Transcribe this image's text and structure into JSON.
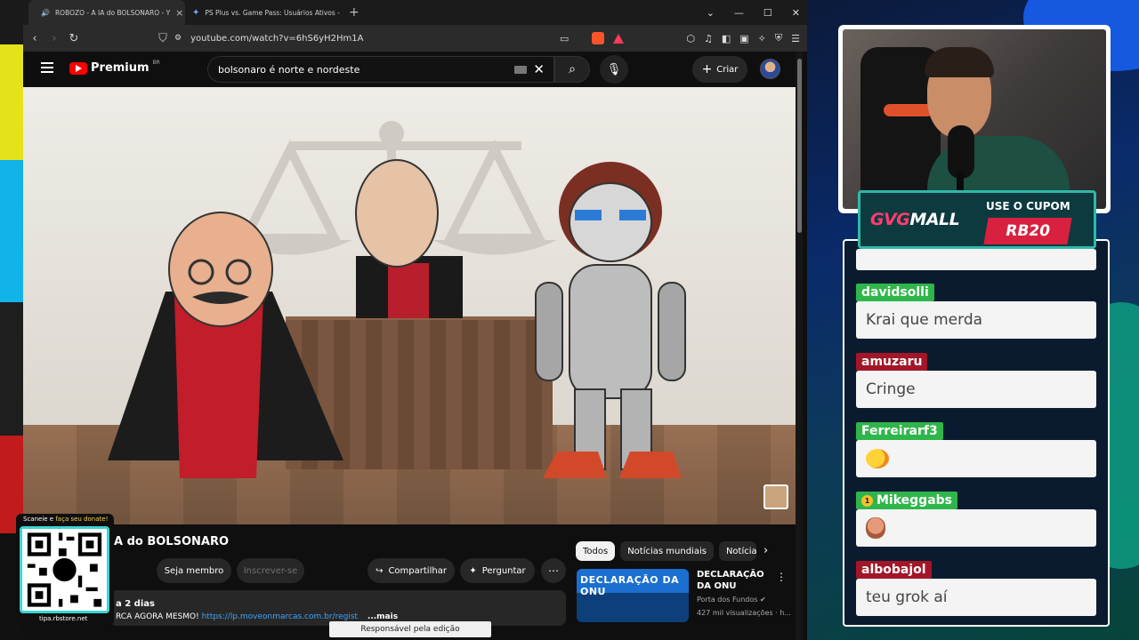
{
  "browser": {
    "tabs": [
      {
        "title": "ROBOZO - A IA do BOLSONARO - Y",
        "active": true
      },
      {
        "title": "PS Plus vs. Game Pass: Usuários Ativos - Goo",
        "active": false
      }
    ],
    "url": "youtube.com/watch?v=6hS6yH2Hm1A"
  },
  "youtube": {
    "brand": "Premium",
    "region": "BR",
    "search_query": "bolsonaro é norte e nordeste",
    "create_label": "Criar",
    "video_title_visible": "A do BOLSONARO",
    "join_label": "Seja membro",
    "subscribe_label": "Inscrever-se",
    "share_label": "Compartilhar",
    "ask_label": "Perguntar",
    "description_date": "a 2 dias",
    "description_text": "RCA AGORA MESMO! ",
    "description_link": "https://lp.moveonmarcas.com.br/regist",
    "description_more": "...mais",
    "chips": [
      "Todos",
      "Notícias mundiais",
      "Notícia"
    ],
    "recommended": {
      "thumb_text": "DECLARAÇÃO DA ONU",
      "title": "DECLARAÇÃO DA ONU",
      "channel": "Porta dos Fundos",
      "views": "427 mil visualizações · h..."
    },
    "status_tooltip": "Responsável pela edição"
  },
  "qr": {
    "caption_prefix": "Scaneie e ",
    "caption_highlight": "faça seu donate!",
    "url": "tipa.rbstore.net"
  },
  "stream": {
    "sponsor_logo_g": "GVG",
    "sponsor_logo_rest": "MALL",
    "cupom_label": "USE O CUPOM",
    "cupom_code": "RB20"
  },
  "chat": [
    {
      "user": "davidsolli",
      "message": "Krai que merda",
      "color": "#2fb64a"
    },
    {
      "user": "amuzaru",
      "message": "Cringe",
      "color": "#a11628"
    },
    {
      "user": "Ferreirarf3",
      "message": "",
      "emote": "chick-emote",
      "color": "#2fb64a"
    },
    {
      "user": "Mikeggabs",
      "message": "",
      "emote": "face-emote",
      "badge": "1",
      "color": "#2fb64a"
    },
    {
      "user": "albobajol",
      "message": "teu grok aí",
      "color": "#a11628"
    }
  ]
}
